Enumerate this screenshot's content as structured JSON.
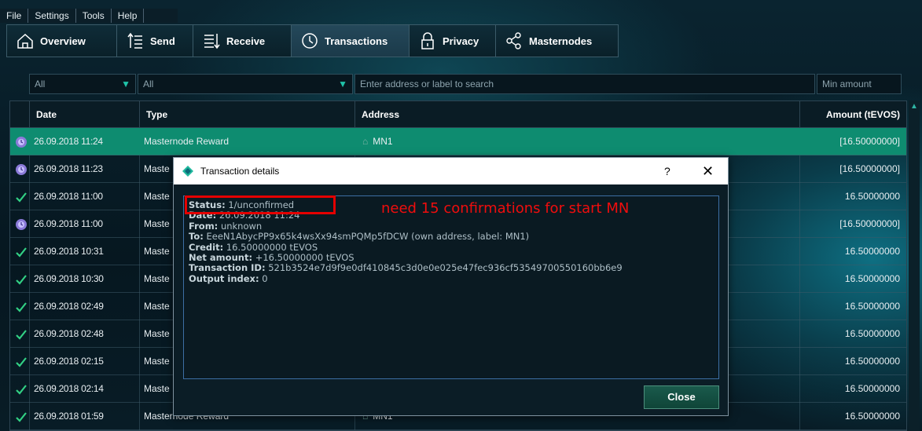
{
  "menu": [
    "File",
    "Settings",
    "Tools",
    "Help"
  ],
  "toolbar": [
    {
      "label": "Overview",
      "icon": "home-icon"
    },
    {
      "label": "Send",
      "icon": "send-icon"
    },
    {
      "label": "Receive",
      "icon": "receive-icon"
    },
    {
      "label": "Transactions",
      "icon": "clock-icon"
    },
    {
      "label": "Privacy",
      "icon": "lock-icon"
    },
    {
      "label": "Masternodes",
      "icon": "share-nodes-icon"
    }
  ],
  "filters": {
    "date": "All",
    "type": "All",
    "search_placeholder": "Enter address or label to search",
    "amount_placeholder": "Min amount"
  },
  "table": {
    "headers": [
      "Date",
      "Type",
      "Address",
      "Amount (tEVOS)"
    ],
    "rows": [
      {
        "status": "clock-icon",
        "date": "26.09.2018 11:24",
        "type": "Masternode Reward",
        "address": "MN1",
        "amount": "[16.50000000]"
      },
      {
        "status": "clock-icon",
        "date": "26.09.2018 11:23",
        "type": "Maste",
        "address": "",
        "amount": "[16.50000000]"
      },
      {
        "status": "check-icon",
        "date": "26.09.2018 11:00",
        "type": "Maste",
        "address": "",
        "amount": "16.50000000"
      },
      {
        "status": "clock-icon",
        "date": "26.09.2018 11:00",
        "type": "Maste",
        "address": "",
        "amount": "[16.50000000]"
      },
      {
        "status": "check-icon",
        "date": "26.09.2018 10:31",
        "type": "Maste",
        "address": "",
        "amount": "16.50000000"
      },
      {
        "status": "check-icon",
        "date": "26.09.2018 10:30",
        "type": "Maste",
        "address": "",
        "amount": "16.50000000"
      },
      {
        "status": "check-icon",
        "date": "26.09.2018 02:49",
        "type": "Maste",
        "address": "",
        "amount": "16.50000000"
      },
      {
        "status": "check-icon",
        "date": "26.09.2018 02:48",
        "type": "Maste",
        "address": "",
        "amount": "16.50000000"
      },
      {
        "status": "check-icon",
        "date": "26.09.2018 02:15",
        "type": "Maste",
        "address": "",
        "amount": "16.50000000"
      },
      {
        "status": "check-icon",
        "date": "26.09.2018 02:14",
        "type": "Maste",
        "address": "",
        "amount": "16.50000000"
      },
      {
        "status": "check-icon",
        "date": "26.09.2018 01:59",
        "type": "Masternode Reward",
        "address": "MN1",
        "amount": "16.50000000"
      }
    ]
  },
  "dialog": {
    "title": "Transaction details",
    "help": "?",
    "close_x": "✕",
    "lines": [
      {
        "label": "Status:",
        "value": "1/unconfirmed"
      },
      {
        "label": "Date:",
        "value": "26.09.2018 11:24"
      },
      {
        "label": "From:",
        "value": "unknown"
      },
      {
        "label": "To:",
        "value": "EeeN1AbycPP9x65k4wsXx94smPQMp5fDCW (own address, label: MN1)"
      },
      {
        "label": "Credit:",
        "value": "16.50000000 tEVOS"
      },
      {
        "label": "Net amount:",
        "value": "+16.50000000 tEVOS"
      },
      {
        "label": "Transaction ID:",
        "value": "521b3524e7d9f9e0df410845c3d0e0e025e47fec936cf53549700550160bb6e9"
      },
      {
        "label": "Output index:",
        "value": "0"
      }
    ],
    "note": "need 15 confirmations for start MN",
    "close_label": "Close"
  },
  "colors": {
    "accent": "#0e8c70",
    "note": "#f00d0d",
    "clock": "#8a7ad8",
    "check": "#32d084"
  }
}
